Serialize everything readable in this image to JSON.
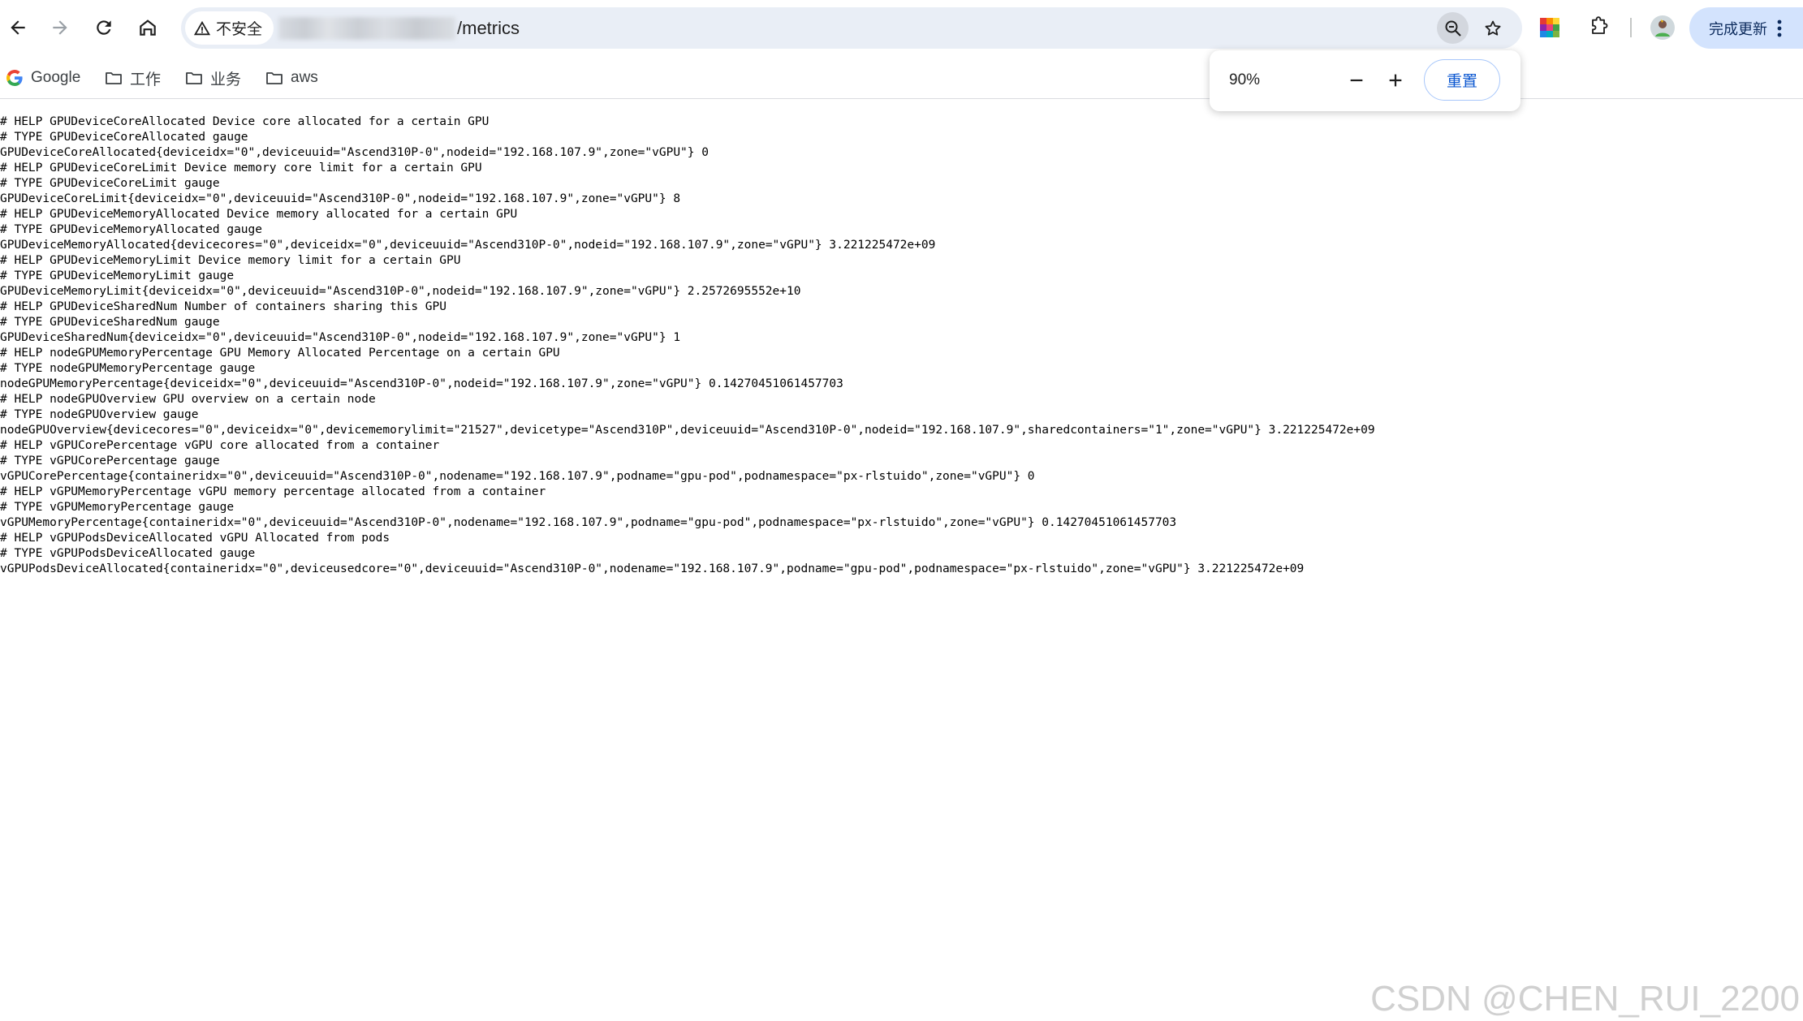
{
  "browser": {
    "security_label": "不安全",
    "url_path": "/metrics",
    "update_label": "完成更新"
  },
  "bookmarks": [
    {
      "label": "Google",
      "icon": "google-g-icon"
    },
    {
      "label": "工作",
      "icon": "folder-icon"
    },
    {
      "label": "业务",
      "icon": "folder-icon"
    },
    {
      "label": "aws",
      "icon": "folder-icon"
    }
  ],
  "zoom_popup": {
    "level": "90%",
    "reset_label": "重置"
  },
  "metrics": [
    "# HELP GPUDeviceCoreAllocated Device core allocated for a certain GPU",
    "# TYPE GPUDeviceCoreAllocated gauge",
    "GPUDeviceCoreAllocated{deviceidx=\"0\",deviceuuid=\"Ascend310P-0\",nodeid=\"192.168.107.9\",zone=\"vGPU\"} 0",
    "# HELP GPUDeviceCoreLimit Device memory core limit for a certain GPU",
    "# TYPE GPUDeviceCoreLimit gauge",
    "GPUDeviceCoreLimit{deviceidx=\"0\",deviceuuid=\"Ascend310P-0\",nodeid=\"192.168.107.9\",zone=\"vGPU\"} 8",
    "# HELP GPUDeviceMemoryAllocated Device memory allocated for a certain GPU",
    "# TYPE GPUDeviceMemoryAllocated gauge",
    "GPUDeviceMemoryAllocated{devicecores=\"0\",deviceidx=\"0\",deviceuuid=\"Ascend310P-0\",nodeid=\"192.168.107.9\",zone=\"vGPU\"} 3.221225472e+09",
    "# HELP GPUDeviceMemoryLimit Device memory limit for a certain GPU",
    "# TYPE GPUDeviceMemoryLimit gauge",
    "GPUDeviceMemoryLimit{deviceidx=\"0\",deviceuuid=\"Ascend310P-0\",nodeid=\"192.168.107.9\",zone=\"vGPU\"} 2.2572695552e+10",
    "# HELP GPUDeviceSharedNum Number of containers sharing this GPU",
    "# TYPE GPUDeviceSharedNum gauge",
    "GPUDeviceSharedNum{deviceidx=\"0\",deviceuuid=\"Ascend310P-0\",nodeid=\"192.168.107.9\",zone=\"vGPU\"} 1",
    "# HELP nodeGPUMemoryPercentage GPU Memory Allocated Percentage on a certain GPU",
    "# TYPE nodeGPUMemoryPercentage gauge",
    "nodeGPUMemoryPercentage{deviceidx=\"0\",deviceuuid=\"Ascend310P-0\",nodeid=\"192.168.107.9\",zone=\"vGPU\"} 0.14270451061457703",
    "# HELP nodeGPUOverview GPU overview on a certain node",
    "# TYPE nodeGPUOverview gauge",
    "nodeGPUOverview{devicecores=\"0\",deviceidx=\"0\",devicememorylimit=\"21527\",devicetype=\"Ascend310P\",deviceuuid=\"Ascend310P-0\",nodeid=\"192.168.107.9\",sharedcontainers=\"1\",zone=\"vGPU\"} 3.221225472e+09",
    "# HELP vGPUCorePercentage vGPU core allocated from a container",
    "# TYPE vGPUCorePercentage gauge",
    "vGPUCorePercentage{containeridx=\"0\",deviceuuid=\"Ascend310P-0\",nodename=\"192.168.107.9\",podname=\"gpu-pod\",podnamespace=\"px-rlstuido\",zone=\"vGPU\"} 0",
    "# HELP vGPUMemoryPercentage vGPU memory percentage allocated from a container",
    "# TYPE vGPUMemoryPercentage gauge",
    "vGPUMemoryPercentage{containeridx=\"0\",deviceuuid=\"Ascend310P-0\",nodename=\"192.168.107.9\",podname=\"gpu-pod\",podnamespace=\"px-rlstuido\",zone=\"vGPU\"} 0.14270451061457703",
    "# HELP vGPUPodsDeviceAllocated vGPU Allocated from pods",
    "# TYPE vGPUPodsDeviceAllocated gauge",
    "vGPUPodsDeviceAllocated{containeridx=\"0\",deviceusedcore=\"0\",deviceuuid=\"Ascend310P-0\",nodename=\"192.168.107.9\",podname=\"gpu-pod\",podnamespace=\"px-rlstuido\",zone=\"vGPU\"} 3.221225472e+09"
  ],
  "watermark": "CSDN @CHEN_RUI_2200",
  "colors": {
    "omnibox_bg": "#e9eef6",
    "accent_blue": "#0b57d0",
    "update_bg": "#d3e3fd"
  }
}
